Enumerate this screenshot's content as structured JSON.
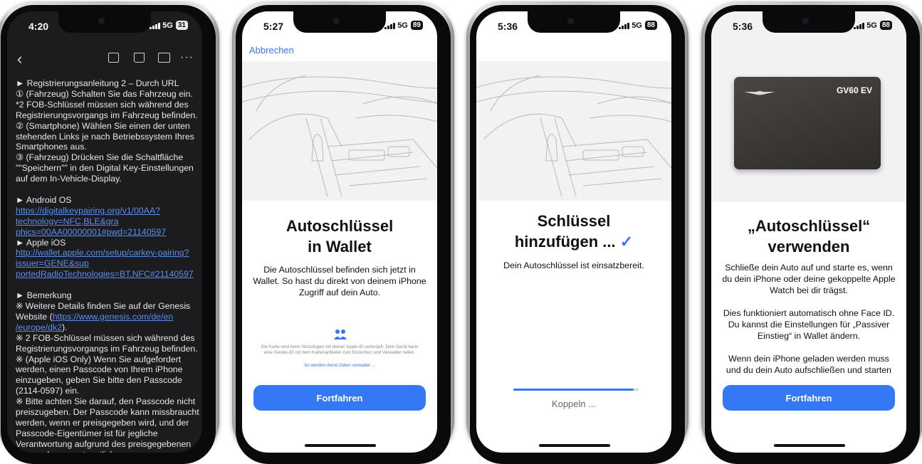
{
  "phone1": {
    "time": "4:20",
    "network": "5G",
    "battery": "31",
    "lines": [
      {
        "t": "► Registrierungsanleitung 2 – Durch URL",
        "link": false
      },
      {
        "t": "① (Fahrzeug) Schalten Sie das Fahrzeug ein.",
        "link": false
      },
      {
        "t": "*2 FOB-Schlüssel müssen sich während des",
        "link": false
      },
      {
        "t": "Registrierungsvorgangs im Fahrzeug befinden.",
        "link": false
      },
      {
        "t": "② (Smartphone) Wählen Sie einen der unten",
        "link": false
      },
      {
        "t": "stehenden Links je nach Betriebssystem Ihres",
        "link": false
      },
      {
        "t": "Smartphones aus.",
        "link": false
      },
      {
        "t": "③ (Fahrzeug) Drücken Sie die Schaltfläche",
        "link": false
      },
      {
        "t": "\"\"Speichern\"\" in den Digital Key-Einstellungen",
        "link": false
      },
      {
        "t": "auf dem In-Vehicle-Display.",
        "link": false
      },
      {
        "t": "",
        "link": false
      },
      {
        "t": "► Android OS",
        "link": false
      },
      {
        "t": "https://digitalkeypairing.org/v1/00AA?",
        "link": true
      },
      {
        "t": "technology=NFC,BLE&gra",
        "link": true
      },
      {
        "t": "phics=00AA00000001#pwd=21140597",
        "link": true
      },
      {
        "t": "► Apple iOS",
        "link": false
      },
      {
        "t": "http://wallet.apple.com/setup/carkey-pairing?",
        "link": true
      },
      {
        "t": "issuer=GENE&sup",
        "link": true
      },
      {
        "t": "portedRadioTechnologies=BT,NFC#21140597",
        "link": true
      },
      {
        "t": "",
        "link": false
      },
      {
        "t": "► Bemerkung",
        "link": false
      },
      {
        "t": "※ Weitere Details finden Sie auf der Genesis",
        "link": false
      },
      {
        "t": "Website (",
        "link": false,
        "tail": "https://www.genesis.com/de/en"
      },
      {
        "t": "/europe/dk2",
        "link": true,
        "after": ")."
      },
      {
        "t": "※ 2 FOB-Schlüssel müssen sich während des",
        "link": false
      },
      {
        "t": "Registrierungsvorgangs im Fahrzeug befinden.",
        "link": false
      },
      {
        "t": "※ (Apple iOS Only) Wenn Sie aufgefordert",
        "link": false
      },
      {
        "t": "werden, einen Passcode von Ihrem iPhone",
        "link": false
      },
      {
        "t": "einzugeben, geben Sie bitte den Passcode",
        "link": false
      },
      {
        "t": "(2114-0597) ein.",
        "link": false
      },
      {
        "t": "※ Bitte achten Sie darauf, den Passcode nicht",
        "link": false
      },
      {
        "t": "preiszugeben. Der Passcode kann missbraucht",
        "link": false
      },
      {
        "t": "werden, wenn er preisgegeben wird, und der",
        "link": false
      },
      {
        "t": "Passcode-Eigentümer ist für jegliche",
        "link": false
      },
      {
        "t": "Verantwortung aufgrund des preisgegebenen",
        "link": false
      },
      {
        "t": "Passcodes verantwortlich.",
        "link": false
      }
    ]
  },
  "phone2": {
    "time": "5:27",
    "network": "5G",
    "battery": "89",
    "cancel_label": "Abbrechen",
    "title_line1": "Autoschlüssel",
    "title_line2": "in Wallet",
    "body": "Die Autoschlüssel befinden sich jetzt in Wallet. So hast du direkt von deinem iPhone Zugriff auf dein Auto.",
    "privacy_text": "Die Karte wird beim Hinzufügen mit deiner Apple-ID verknüpft. Dein Gerät kann eine Geräte-ID mit dem Kartenanbieter zum Einrichten und Verwalten teilen.",
    "privacy_link": "So werden deine Daten verwaltet ...",
    "button_label": "Fortfahren"
  },
  "phone3": {
    "time": "5:36",
    "network": "5G",
    "battery": "88",
    "title_line1": "Schlüssel",
    "title_line2": "hinzufügen ...",
    "check": "✓",
    "body": "Dein Autoschlüssel ist einsatzbereit.",
    "progress": 0.96,
    "pairing_label": "Koppeln ..."
  },
  "phone4": {
    "time": "5:36",
    "network": "5G",
    "battery": "88",
    "card_model": "GV60 EV",
    "title_line1": "„Autoschlüssel“",
    "title_line2": "verwenden",
    "para1": "Schließe dein Auto auf und starte es, wenn du dein iPhone oder deine gekoppelte Apple Watch bei dir trägst.",
    "para2": "Dies funktioniert automatisch ohne Face ID. Du kannst die Einstellungen für „Passiver Einstieg“ in Wallet ändern.",
    "para3": "Wenn dein iPhone geladen werden muss und du dein Auto aufschließen und starten",
    "button_label": "Fortfahren"
  },
  "colors": {
    "accent": "#3478f6",
    "dark_bg": "#1c1c1e",
    "link": "#5b8ef0"
  }
}
